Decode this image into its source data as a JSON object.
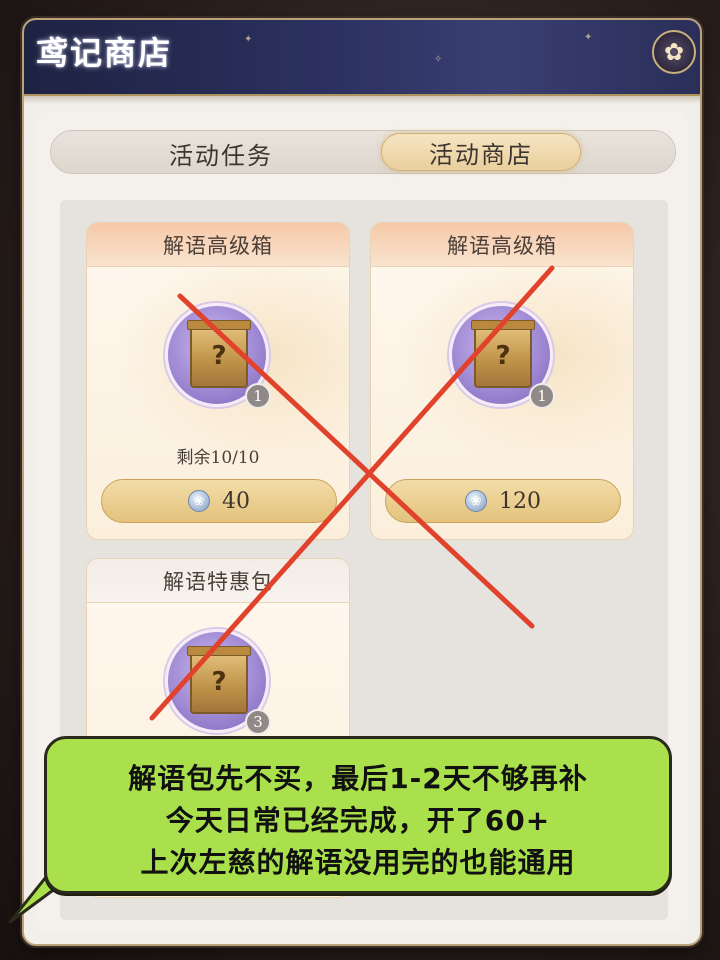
{
  "window": {
    "title": "鸢记商店",
    "settings_icon": "flower-icon"
  },
  "tabs": [
    {
      "label": "活动任务",
      "active": false
    },
    {
      "label": "活动商店",
      "active": true
    }
  ],
  "items": [
    {
      "name": "解语高级箱",
      "quantity": "1",
      "remaining": "剩余10/10",
      "price": "40",
      "icon": "mystery-chest-icon",
      "crossed_out": true
    },
    {
      "name": "解语高级箱",
      "quantity": "1",
      "remaining": "",
      "price": "120",
      "icon": "mystery-chest-icon",
      "crossed_out": true
    },
    {
      "name": "解语特惠包",
      "quantity": "3",
      "remaining": "",
      "price": "",
      "icon": "mystery-chest-icon",
      "crossed_out": true
    }
  ],
  "currency_icon": "coin-icon",
  "annotation": {
    "lines": [
      "解语包先不买，最后1-2天不够再补",
      "今天日常已经完成，开了60+",
      "上次左慈的解语没用完的也能通用"
    ],
    "bubble_color": "#a9e04c",
    "cross_color": "#e0422c"
  }
}
